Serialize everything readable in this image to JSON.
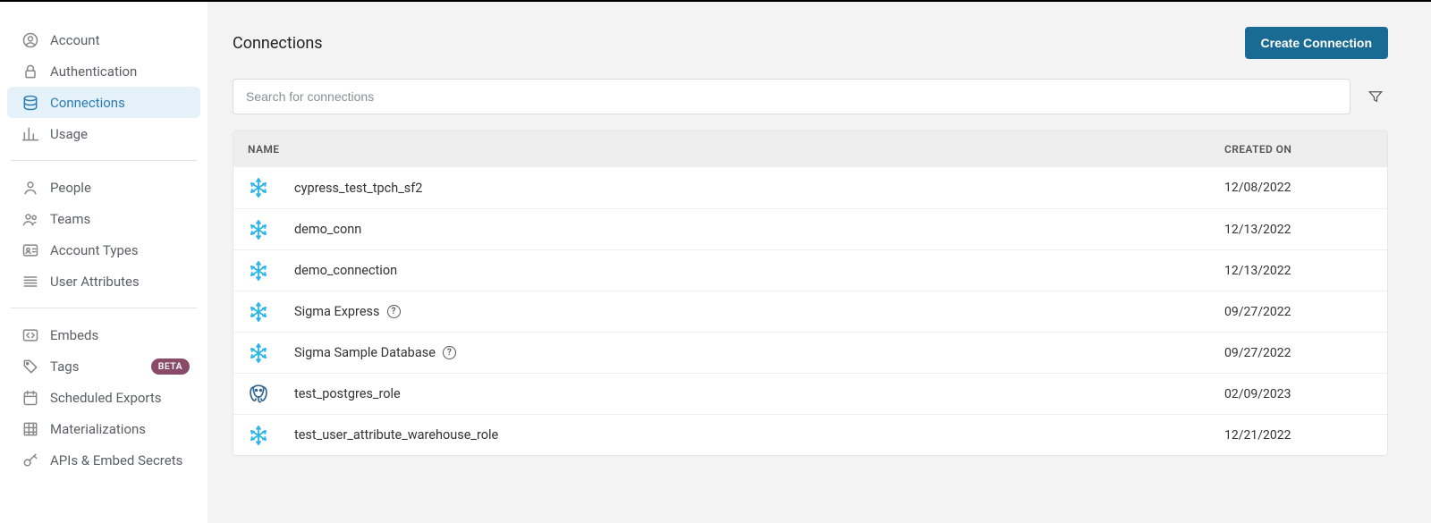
{
  "sidebar": {
    "groups": [
      [
        {
          "key": "account",
          "label": "Account",
          "icon": "user-circle"
        },
        {
          "key": "authentication",
          "label": "Authentication",
          "icon": "lock"
        },
        {
          "key": "connections",
          "label": "Connections",
          "icon": "database",
          "active": true
        },
        {
          "key": "usage",
          "label": "Usage",
          "icon": "chart"
        }
      ],
      [
        {
          "key": "people",
          "label": "People",
          "icon": "person"
        },
        {
          "key": "teams",
          "label": "Teams",
          "icon": "people"
        },
        {
          "key": "account-types",
          "label": "Account Types",
          "icon": "id-card"
        },
        {
          "key": "user-attributes",
          "label": "User Attributes",
          "icon": "lines"
        }
      ],
      [
        {
          "key": "embeds",
          "label": "Embeds",
          "icon": "code"
        },
        {
          "key": "tags",
          "label": "Tags",
          "icon": "tag",
          "badge": "BETA"
        },
        {
          "key": "scheduled-exports",
          "label": "Scheduled Exports",
          "icon": "calendar"
        },
        {
          "key": "materializations",
          "label": "Materializations",
          "icon": "grid"
        },
        {
          "key": "apis",
          "label": "APIs & Embed Secrets",
          "icon": "key"
        }
      ]
    ]
  },
  "page": {
    "title": "Connections",
    "create_button": "Create Connection",
    "search_placeholder": "Search for connections"
  },
  "table": {
    "headers": {
      "name": "NAME",
      "created_on": "CREATED ON"
    },
    "rows": [
      {
        "icon": "snowflake",
        "name": "cypress_test_tpch_sf2",
        "help": false,
        "created_on": "12/08/2022"
      },
      {
        "icon": "snowflake",
        "name": "demo_conn",
        "help": false,
        "created_on": "12/13/2022"
      },
      {
        "icon": "snowflake",
        "name": "demo_connection",
        "help": false,
        "created_on": "12/13/2022"
      },
      {
        "icon": "snowflake",
        "name": "Sigma Express",
        "help": true,
        "created_on": "09/27/2022"
      },
      {
        "icon": "snowflake",
        "name": "Sigma Sample Database",
        "help": true,
        "created_on": "09/27/2022"
      },
      {
        "icon": "postgres",
        "name": "test_postgres_role",
        "help": false,
        "created_on": "02/09/2023"
      },
      {
        "icon": "snowflake",
        "name": "test_user_attribute_warehouse_role",
        "help": false,
        "created_on": "12/21/2022"
      }
    ]
  }
}
